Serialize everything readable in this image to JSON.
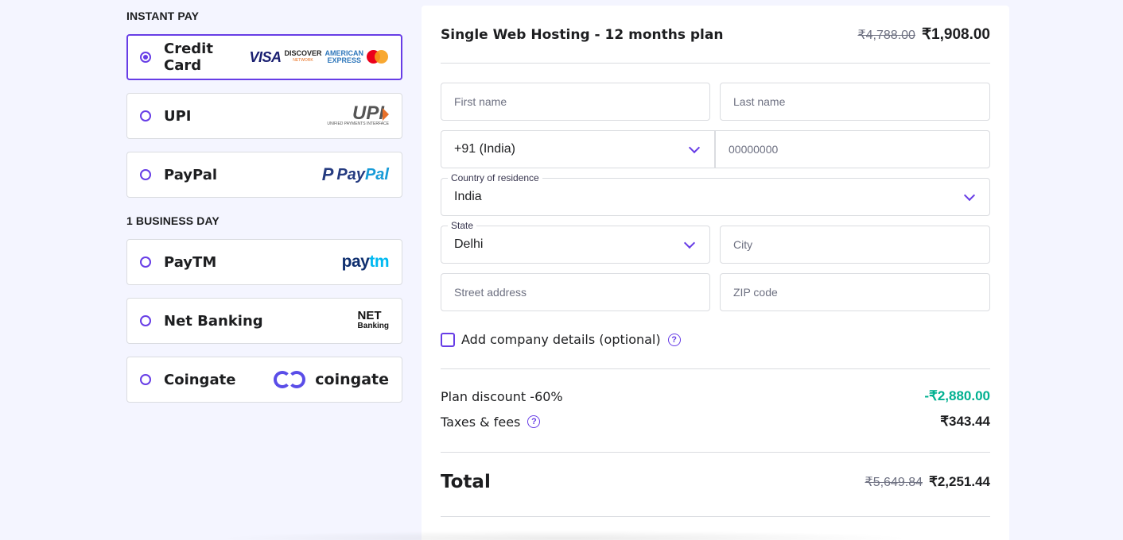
{
  "sections": {
    "instant_pay": "INSTANT PAY",
    "business_day": "1 BUSINESS DAY"
  },
  "payment_methods": [
    {
      "name": "Credit Card",
      "selected": true,
      "logos": [
        "visa-logo",
        "discover-logo",
        "amex-logo",
        "mastercard-logo"
      ]
    },
    {
      "name": "UPI",
      "selected": false,
      "logos": [
        "upi-logo"
      ]
    },
    {
      "name": "PayPal",
      "selected": false,
      "logos": [
        "paypal-logo"
      ]
    },
    {
      "name": "PayTM",
      "selected": false,
      "logos": [
        "paytm-logo"
      ]
    },
    {
      "name": "Net Banking",
      "selected": false,
      "logos": [
        "net-banking-logo"
      ]
    },
    {
      "name": "Coingate",
      "selected": false,
      "logos": [
        "coingate-logo"
      ]
    }
  ],
  "logos": {
    "visa": "VISA",
    "discover_top": "DISCOVER",
    "discover_sub": "NETWORK",
    "amex_1": "AMERICAN",
    "amex_2": "EXPRESS",
    "upi": "UPI",
    "upi_sub": "UNIFIED PAYMENTS INTERFACE",
    "paypal_1": "Pay",
    "paypal_2": "Pal",
    "paytm_1": "pay",
    "paytm_2": "tm",
    "net_1": "NET",
    "net_2": "Banking",
    "coingate": "coingate"
  },
  "plan": {
    "title": "Single Web Hosting - 12 months plan",
    "old_price": "₹4,788.00",
    "new_price": "₹1,908.00"
  },
  "form": {
    "first_name_placeholder": "First name",
    "last_name_placeholder": "Last name",
    "phone_code": "+91 (India)",
    "phone_placeholder": "00000000",
    "country_label": "Country of residence",
    "country_value": "India",
    "state_label": "State",
    "state_value": "Delhi",
    "city_placeholder": "City",
    "street_placeholder": "Street address",
    "zip_placeholder": "ZIP code",
    "company_checkbox": "Add company details (optional)",
    "help": "?"
  },
  "summary": {
    "discount_label": "Plan discount -60%",
    "discount_value": "-₹2,880.00",
    "taxes_label": "Taxes & fees",
    "taxes_value": "₹343.44",
    "total_label": "Total",
    "total_old": "₹5,649.84",
    "total_new": "₹2,251.44"
  },
  "colors": {
    "accent": "#673de6",
    "discount": "#00b090",
    "background": "#f4f5ff"
  }
}
